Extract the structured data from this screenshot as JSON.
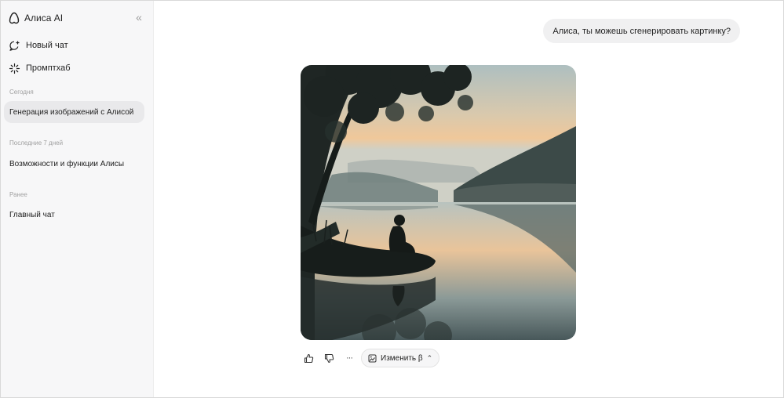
{
  "sidebar": {
    "brand": {
      "title": "Алиса AI",
      "icon": "alice-logo-icon"
    },
    "collapse_icon": "double-chevron-left-icon",
    "collapse_glyph": "«",
    "actions": [
      {
        "label": "Новый чат",
        "icon": "new-chat-icon"
      },
      {
        "label": "Промптхаб",
        "icon": "sparkle-icon"
      }
    ],
    "sections": [
      {
        "label": "Сегодня",
        "items": [
          {
            "label": "Генерация изображений с Алисой",
            "active": true
          }
        ]
      },
      {
        "label": "Последние 7 дней",
        "items": [
          {
            "label": "Возможности и функции Алисы",
            "active": false
          }
        ]
      },
      {
        "label": "Ранее",
        "items": [
          {
            "label": "Главный чат",
            "active": false
          }
        ]
      }
    ]
  },
  "chat": {
    "user_message": "Алиса, ты можешь сгенерировать картинку?",
    "response_image_icon": "generated-image",
    "actions": {
      "like_icon": "thumbs-up-icon",
      "dislike_icon": "thumbs-down-icon",
      "more_icon": "more-dots-icon",
      "more_glyph": "···",
      "edit_label": "Изменить β",
      "edit_icon": "edit-image-icon",
      "edit_chevron": "⌃"
    }
  },
  "colors": {
    "sidebar_bg": "#f7f7f8",
    "active_item_bg": "#e9e9eb",
    "bubble_bg": "#f0f0f1"
  }
}
